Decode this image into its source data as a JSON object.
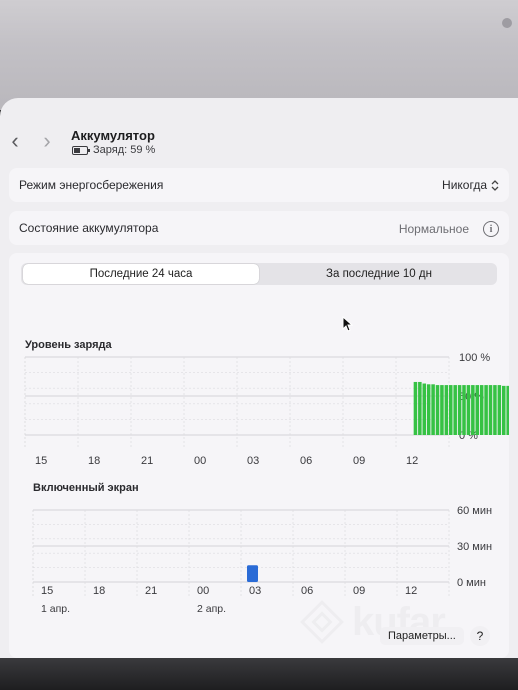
{
  "window": {
    "title": "Аккумулятор",
    "subtitle": "Заряд: 59 %",
    "nav_back_glyph": "‹",
    "nav_forward_glyph": "›"
  },
  "low_power_mode": {
    "label": "Режим энергосбережения",
    "value": "Никогда"
  },
  "battery_health": {
    "label": "Состояние аккумулятора",
    "value": "Нормальное",
    "info_glyph": "i"
  },
  "tabs": {
    "items": [
      "Последние 24 часа",
      "За последние 10 дн"
    ],
    "selected": "Последние 24 часа"
  },
  "footer": {
    "options_label": "Параметры...",
    "help_label": "?"
  },
  "watermark": {
    "text": "kufar"
  },
  "colors": {
    "battery_bar": "#36c244",
    "screen_bar": "#2a6bd6",
    "grid": "#d4d4d8",
    "grid_dash": "#dcdcdf"
  },
  "chart_data": [
    {
      "type": "bar",
      "title": "Уровень заряда",
      "x_tick_labels": [
        "15",
        "18",
        "21",
        "00",
        "03",
        "06",
        "09",
        "12"
      ],
      "y_tick_labels": [
        "100 %",
        "50 %",
        "0 %"
      ],
      "ylim": [
        0,
        100
      ],
      "values": [
        0,
        0,
        0,
        0,
        0,
        0,
        0,
        0,
        0,
        0,
        0,
        0,
        0,
        0,
        0,
        0,
        0,
        0,
        0,
        0,
        0,
        0,
        0,
        0,
        0,
        0,
        0,
        0,
        0,
        0,
        0,
        0,
        0,
        0,
        0,
        0,
        0,
        0,
        0,
        0,
        0,
        0,
        0,
        0,
        0,
        0,
        0,
        0,
        0,
        0,
        0,
        0,
        0,
        0,
        0,
        0,
        0,
        0,
        0,
        0,
        0,
        0,
        0,
        0,
        0,
        0,
        0,
        0,
        0,
        0,
        0,
        0,
        0,
        0,
        0,
        0,
        0,
        0,
        0,
        0,
        0,
        0,
        0,
        0,
        0,
        0,
        0,
        0,
        68,
        68,
        66,
        65,
        65,
        64,
        64,
        64,
        64,
        64,
        64,
        64,
        64,
        64,
        64,
        64,
        64,
        64,
        64,
        64,
        63,
        63,
        63,
        63,
        63,
        63,
        63,
        63,
        63,
        63,
        63,
        63,
        63,
        63,
        63,
        63,
        63,
        63,
        63,
        63,
        63,
        63,
        63,
        63,
        63,
        63,
        63
      ],
      "start_slot": 88,
      "total_slots": 96,
      "grid": true
    },
    {
      "type": "bar",
      "title": "Включенный экран",
      "x_tick_labels": [
        "15",
        "18",
        "21",
        "00",
        "03",
        "06",
        "09",
        "12"
      ],
      "date_labels": [
        "1 апр.",
        "2 апр."
      ],
      "y_tick_labels": [
        "60 мин",
        "30 мин",
        "0 мин"
      ],
      "ylim": [
        0,
        60
      ],
      "bars": [
        {
          "x": "03",
          "value": 14
        }
      ],
      "grid": true
    }
  ]
}
